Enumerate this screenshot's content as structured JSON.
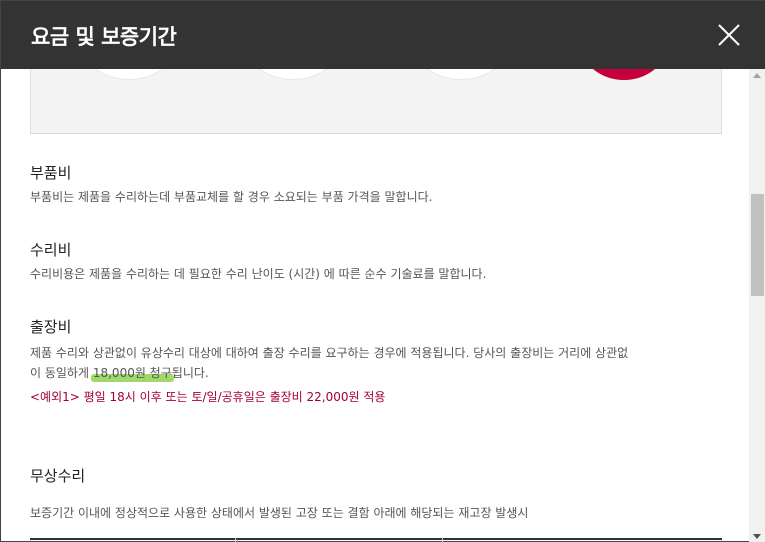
{
  "header": {
    "title": "요금 및 보증기간",
    "close_icon": "close-icon"
  },
  "sections": {
    "parts": {
      "title": "부품비",
      "desc": "부품비는 제품을 수리하는데 부품교체를 할 경우 소요되는 부품 가격을 말합니다."
    },
    "repair": {
      "title": "수리비",
      "desc": "수리비용은 제품을 수리하는 데 필요한 수리 난이도 (시간) 에 따른 순수 기술료를 말합니다."
    },
    "visit": {
      "title": "출장비",
      "desc_line1": "제품 수리와 상관없이 유상수리 대상에 대하여 출장 수리를 요구하는 경우에 적용됩니다. 당사의 출장비는 거리에 상관없",
      "desc_line2_pre": "이 동일하게 ",
      "desc_line2_highlight": "18,000원 청구",
      "desc_line2_post": "됩니다.",
      "example": "<예외1> 평일 18시 이후 또는 토/일/공휴일은 출장비 22,000원 적용"
    },
    "free": {
      "title": "무상수리",
      "desc": "보증기간 이내에 정상적으로 사용한 상태에서 발생된 고장 또는 결함 아래에 해당되는 재고장 발생시"
    }
  },
  "colors": {
    "header_bg": "#333333",
    "accent": "#a50034",
    "highlight": "#8fd14f"
  }
}
